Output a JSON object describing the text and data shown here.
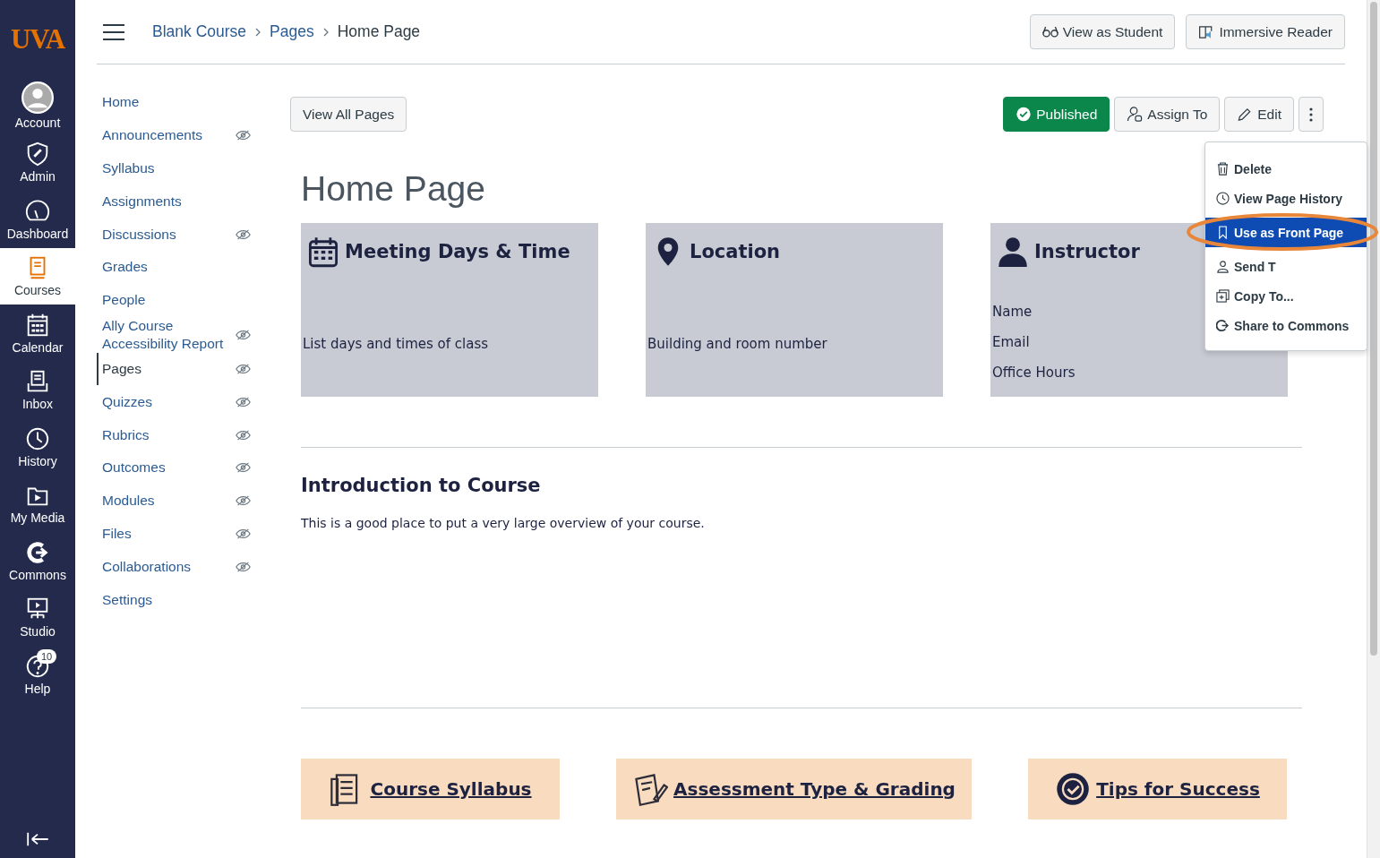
{
  "logo": "UVA",
  "global_nav": [
    {
      "label": "Account",
      "selected": false
    },
    {
      "label": "Admin",
      "selected": false
    },
    {
      "label": "Dashboard",
      "selected": false
    },
    {
      "label": "Courses",
      "selected": true
    },
    {
      "label": "Calendar",
      "selected": false
    },
    {
      "label": "Inbox",
      "selected": false
    },
    {
      "label": "History",
      "selected": false
    },
    {
      "label": "My Media",
      "selected": false
    },
    {
      "label": "Commons",
      "selected": false
    },
    {
      "label": "Studio",
      "selected": false
    },
    {
      "label": "Help",
      "selected": false,
      "badge": "10"
    }
  ],
  "breadcrumbs": [
    "Blank Course",
    "Pages",
    "Home Page"
  ],
  "header_buttons": [
    "View as Student",
    "Immersive Reader"
  ],
  "course_nav": [
    {
      "label": "Home",
      "hidden": false,
      "selected": false
    },
    {
      "label": "Announcements",
      "hidden": true,
      "selected": false
    },
    {
      "label": "Syllabus",
      "hidden": false,
      "selected": false
    },
    {
      "label": "Assignments",
      "hidden": false,
      "selected": false
    },
    {
      "label": "Discussions",
      "hidden": true,
      "selected": false
    },
    {
      "label": "Grades",
      "hidden": false,
      "selected": false
    },
    {
      "label": "People",
      "hidden": false,
      "selected": false
    },
    {
      "label": "Ally Course Accessibility Report",
      "hidden": true,
      "selected": false
    },
    {
      "label": "Pages",
      "hidden": true,
      "selected": true
    },
    {
      "label": "Quizzes",
      "hidden": true,
      "selected": false
    },
    {
      "label": "Rubrics",
      "hidden": true,
      "selected": false
    },
    {
      "label": "Outcomes",
      "hidden": true,
      "selected": false
    },
    {
      "label": "Modules",
      "hidden": true,
      "selected": false
    },
    {
      "label": "Files",
      "hidden": true,
      "selected": false
    },
    {
      "label": "Collaborations",
      "hidden": true,
      "selected": false
    },
    {
      "label": "Settings",
      "hidden": false,
      "selected": false
    }
  ],
  "toolbar": {
    "view_all": "View All Pages",
    "published": "Published",
    "assign": "Assign To",
    "edit": "Edit"
  },
  "menu": [
    {
      "label": "Delete",
      "selected": false
    },
    {
      "label": "View Page History",
      "selected": false
    },
    {
      "label": "Use as Front Page",
      "selected": true
    },
    {
      "label": "Send T",
      "selected": false
    },
    {
      "label": "Copy To...",
      "selected": false
    },
    {
      "label": "Share to Commons",
      "selected": false
    }
  ],
  "page": {
    "title": "Home Page",
    "info_cards": [
      {
        "title": "Meeting Days & Time",
        "lines": [
          "List days and times of class"
        ]
      },
      {
        "title": "Location",
        "lines": [
          "Building and room number"
        ]
      },
      {
        "title": "Instructor",
        "lines": [
          "Name",
          "Email",
          "Office Hours"
        ]
      }
    ],
    "intro_heading": "Introduction to Course",
    "intro_text": "This is a good place to put a very large overview of your course.",
    "link_cards": [
      "Course Syllabus",
      "Assessment Type & Grading",
      "Tips for Success"
    ]
  }
}
